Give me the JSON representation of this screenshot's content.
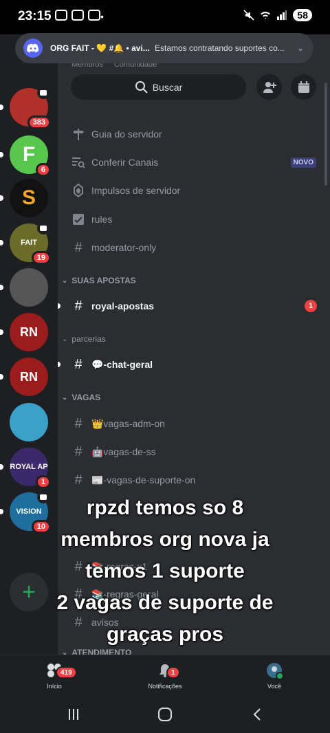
{
  "status_bar": {
    "time": "23:15",
    "battery": "58"
  },
  "notification": {
    "title": "ORG FAIT - 💛 #🔔 • avi...",
    "body": "Estamos contratando suportes co...",
    "icon": "discord-icon"
  },
  "header": {
    "members_label": "Membros",
    "community_label": "Comunidade",
    "search_label": "Buscar"
  },
  "servers": [
    {
      "name": "server-1",
      "color": "#b0302a",
      "badge": "383",
      "voice": true,
      "pip": true
    },
    {
      "name": "server-f",
      "letter": "F",
      "color": "#57c84d",
      "badge": "6",
      "voice": false,
      "pip": true
    },
    {
      "name": "server-s",
      "letter": "S",
      "color": "#111111",
      "letter_color": "#f5a623",
      "voice": false,
      "pip": true
    },
    {
      "name": "server-fait",
      "letter": "FAIT",
      "color": "#6b6b2a",
      "badge": "19",
      "voice": true,
      "pip": true
    },
    {
      "name": "server-5",
      "color": "#555555",
      "voice": false,
      "pip": true
    },
    {
      "name": "server-rn-1",
      "letter": "RN",
      "color": "#9b1c1c",
      "voice": false,
      "pip": true
    },
    {
      "name": "server-rn-2",
      "letter": "RN",
      "color": "#9b1c1c",
      "voice": false,
      "pip": true
    },
    {
      "name": "server-8",
      "color": "#3aa0c8",
      "voice": false,
      "pip": false
    },
    {
      "name": "server-royal-ap",
      "letter": "ROYAL AP",
      "color": "#3b2a6b",
      "badge": "1",
      "voice": false,
      "pip": true
    },
    {
      "name": "server-vision",
      "letter": "VISION",
      "color": "#1f6f9e",
      "badge": "10",
      "voice": true,
      "pip": true
    }
  ],
  "channels": {
    "guide": "Guia do servidor",
    "browse": "Conferir Canais",
    "browse_badge": "NOVO",
    "boosts": "Impulsos de servidor",
    "rules": "rules",
    "moderator": "moderator-only",
    "cat_suas_apostas": "SUAS APOSTAS",
    "royal_apostas": "royal-apostas",
    "royal_apostas_count": "1",
    "cat_parcerias": "parcerias",
    "chat_geral": "💬-chat-geral",
    "cat_vagas": "VAGAS",
    "vagas_adm": "👑vagas-adm-on",
    "vagas_ss": "🤖vagas-de-ss",
    "vagas_suporte": "📰-vagas-de-suporte-on",
    "regras_x1": "📚-regras-x1",
    "regras_geral": "📚-regras-geral",
    "avisos": "avisos",
    "cat_atendimento": "ATENDIMENTO"
  },
  "caption": {
    "line1": "rpzd temos so 8",
    "line2": "membros org nova ja",
    "line3": "temos 1 suporte",
    "line4": "2 vagas de suporte de",
    "line5": "graças pros"
  },
  "tabs": {
    "home": "Início",
    "home_badge": "419",
    "notifications": "Notificações",
    "notifications_badge": "1",
    "you": "Você"
  },
  "colors": {
    "accent": "#5865f2",
    "badge": "#f23f43",
    "online": "#23a55a"
  }
}
